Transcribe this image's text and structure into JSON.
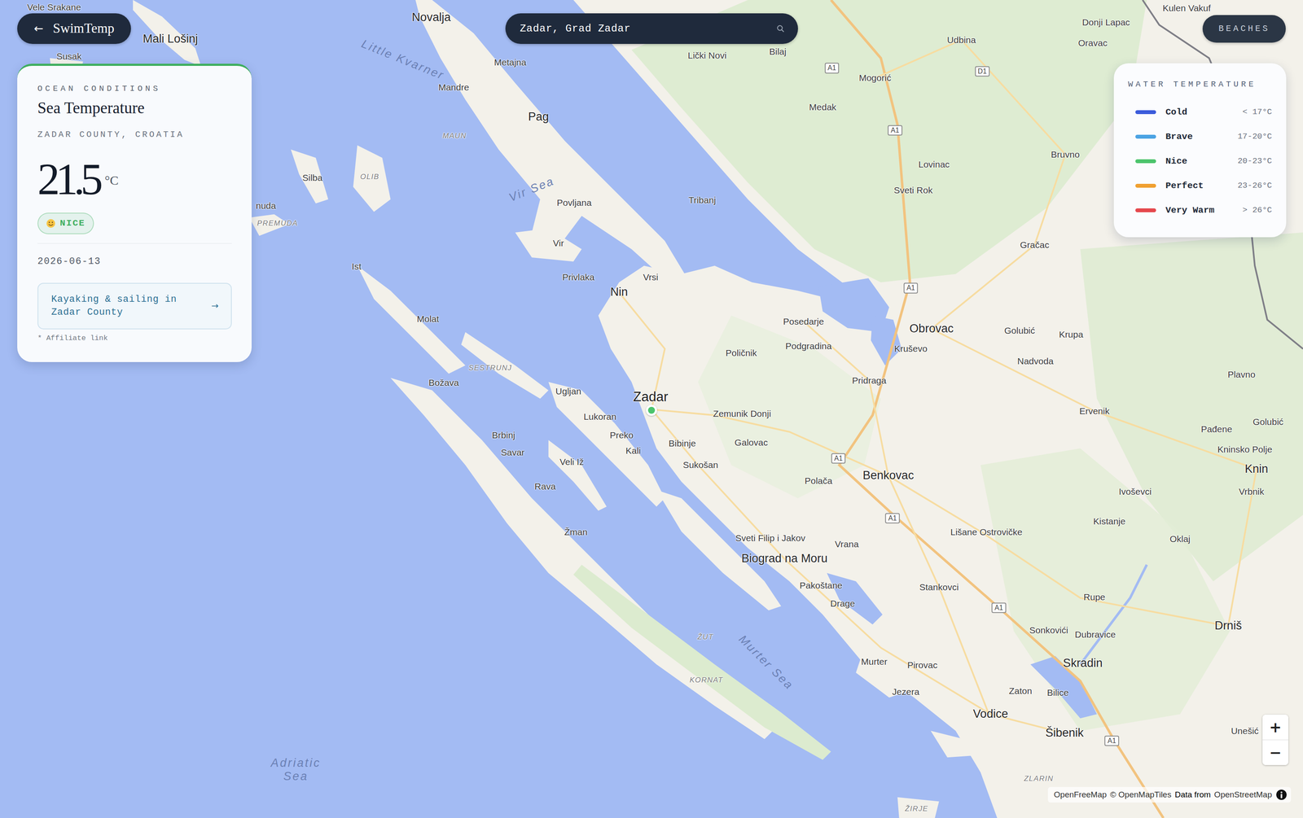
{
  "app": {
    "back_icon": "←",
    "title": "SwimTemp"
  },
  "search": {
    "value": "Zadar, Grad Zadar"
  },
  "beaches_button": "BEACHES",
  "conditions": {
    "eyebrow": "OCEAN CONDITIONS",
    "title": "Sea Temperature",
    "region": "ZADAR COUNTY, CROATIA",
    "temperature": "21.5",
    "unit": "°C",
    "rating": {
      "label": "NICE",
      "color": "#3fae5f"
    },
    "date": "2026-06-13",
    "affiliate": {
      "text": "Kayaking & sailing in Zadar County",
      "arrow": "→"
    },
    "affiliate_note": "* Affiliate link"
  },
  "legend": {
    "title": "WATER TEMPERATURE",
    "items": [
      {
        "label": "Cold",
        "range": "< 17°C",
        "color": "#3b5bdb"
      },
      {
        "label": "Brave",
        "range": "17-20°C",
        "color": "#4ba3e3"
      },
      {
        "label": "Nice",
        "range": "20-23°C",
        "color": "#4cc46c"
      },
      {
        "label": "Perfect",
        "range": "23-26°C",
        "color": "#f0a030"
      },
      {
        "label": "Very Warm",
        "range": "> 26°C",
        "color": "#e5484d"
      }
    ]
  },
  "map": {
    "pins": [
      {
        "color": "#4cc46c"
      }
    ],
    "labels": [
      {
        "text": "Vele Srakane",
        "kind": "town"
      },
      {
        "text": "Mali Lošinj",
        "kind": "city"
      },
      {
        "text": "Susak",
        "kind": "town"
      },
      {
        "text": "Novalja",
        "kind": "city"
      },
      {
        "text": "Metajna",
        "kind": "town"
      },
      {
        "text": "Mandre",
        "kind": "town"
      },
      {
        "text": "Pag",
        "kind": "city"
      },
      {
        "text": "Lički Novi",
        "kind": "town"
      },
      {
        "text": "Bilaj",
        "kind": "town"
      },
      {
        "text": "Medak",
        "kind": "town"
      },
      {
        "text": "Mogorić",
        "kind": "town"
      },
      {
        "text": "Udbina",
        "kind": "town"
      },
      {
        "text": "Donji Lapac",
        "kind": "town"
      },
      {
        "text": "Oravac",
        "kind": "town"
      },
      {
        "text": "Kulen Vakuf",
        "kind": "town"
      },
      {
        "text": "Bruvno",
        "kind": "town"
      },
      {
        "text": "Lovinac",
        "kind": "town"
      },
      {
        "text": "Sveti Rok",
        "kind": "town"
      },
      {
        "text": "Gračac",
        "kind": "town"
      },
      {
        "text": "Tribanj",
        "kind": "town"
      },
      {
        "text": "Povljana",
        "kind": "town"
      },
      {
        "text": "Vir",
        "kind": "town"
      },
      {
        "text": "Privlaka",
        "kind": "town"
      },
      {
        "text": "Vrsi",
        "kind": "town"
      },
      {
        "text": "Nin",
        "kind": "city"
      },
      {
        "text": "Posedarje",
        "kind": "town"
      },
      {
        "text": "Podgradina",
        "kind": "town"
      },
      {
        "text": "Obrovac",
        "kind": "city"
      },
      {
        "text": "Kruševo",
        "kind": "town"
      },
      {
        "text": "Golubić",
        "kind": "town"
      },
      {
        "text": "Krupa",
        "kind": "town"
      },
      {
        "text": "Nadvoda",
        "kind": "town"
      },
      {
        "text": "Poličnik",
        "kind": "town"
      },
      {
        "text": "Pridraga",
        "kind": "town"
      },
      {
        "text": "Plavno",
        "kind": "town"
      },
      {
        "text": "Ervenik",
        "kind": "town"
      },
      {
        "text": "Zadar",
        "kind": "capital"
      },
      {
        "text": "Zemunik Donji",
        "kind": "town"
      },
      {
        "text": "Bibinje",
        "kind": "town"
      },
      {
        "text": "Galovac",
        "kind": "town"
      },
      {
        "text": "Sukošan",
        "kind": "town"
      },
      {
        "text": "Ugljan",
        "kind": "town"
      },
      {
        "text": "Lukoran",
        "kind": "town"
      },
      {
        "text": "Preko",
        "kind": "town"
      },
      {
        "text": "Kali",
        "kind": "town"
      },
      {
        "text": "Molat",
        "kind": "town"
      },
      {
        "text": "Ist",
        "kind": "town"
      },
      {
        "text": "Silba",
        "kind": "town"
      },
      {
        "text": "Božava",
        "kind": "town"
      },
      {
        "text": "Brbinj",
        "kind": "town"
      },
      {
        "text": "Savar",
        "kind": "town"
      },
      {
        "text": "Veli Iž",
        "kind": "town"
      },
      {
        "text": "Rava",
        "kind": "town"
      },
      {
        "text": "Žman",
        "kind": "town"
      },
      {
        "text": "Polača",
        "kind": "town"
      },
      {
        "text": "Benkovac",
        "kind": "city"
      },
      {
        "text": "Pađene",
        "kind": "town"
      },
      {
        "text": "Golubić",
        "kind": "town"
      },
      {
        "text": "Kninsko Polje",
        "kind": "town"
      },
      {
        "text": "Knin",
        "kind": "city"
      },
      {
        "text": "Vrbnik",
        "kind": "town"
      },
      {
        "text": "Ivoševci",
        "kind": "town"
      },
      {
        "text": "Kistanje",
        "kind": "town"
      },
      {
        "text": "Oklaj",
        "kind": "town"
      },
      {
        "text": "Lišane Ostrovičke",
        "kind": "town"
      },
      {
        "text": "Sveti Filip i Jakov",
        "kind": "town"
      },
      {
        "text": "Biograd na Moru",
        "kind": "city"
      },
      {
        "text": "Vrana",
        "kind": "town"
      },
      {
        "text": "Pakoštane",
        "kind": "town"
      },
      {
        "text": "Drage",
        "kind": "town"
      },
      {
        "text": "Stankovci",
        "kind": "town"
      },
      {
        "text": "Rupe",
        "kind": "town"
      },
      {
        "text": "Sonkovići",
        "kind": "town"
      },
      {
        "text": "Dubravice",
        "kind": "town"
      },
      {
        "text": "Drniš",
        "kind": "city"
      },
      {
        "text": "Skradin",
        "kind": "city"
      },
      {
        "text": "Murter",
        "kind": "town"
      },
      {
        "text": "Pirovac",
        "kind": "town"
      },
      {
        "text": "Jezera",
        "kind": "town"
      },
      {
        "text": "Zaton",
        "kind": "town"
      },
      {
        "text": "Bilice",
        "kind": "town"
      },
      {
        "text": "Vodice",
        "kind": "city"
      },
      {
        "text": "Šibenik",
        "kind": "city"
      },
      {
        "text": "Unešić",
        "kind": "town"
      },
      {
        "text": "nuda",
        "kind": "town"
      },
      {
        "text": "MAUN",
        "kind": "island"
      },
      {
        "text": "OLIB",
        "kind": "island"
      },
      {
        "text": "PREMUDA",
        "kind": "island"
      },
      {
        "text": "SESTRUNJ",
        "kind": "island"
      },
      {
        "text": "ŽUT",
        "kind": "island"
      },
      {
        "text": "KORNAT",
        "kind": "island"
      },
      {
        "text": "ZLARIN",
        "kind": "island"
      },
      {
        "text": "ŽIRJE",
        "kind": "island"
      },
      {
        "text": "Little Kvarner",
        "kind": "sea"
      },
      {
        "text": "Vir Sea",
        "kind": "sea"
      },
      {
        "text": "Murter Sea",
        "kind": "sea"
      },
      {
        "text": "Adriatic Sea",
        "kind": "sea"
      },
      {
        "text": "A1",
        "kind": "road"
      },
      {
        "text": "D1",
        "kind": "road"
      },
      {
        "text": "A1",
        "kind": "road"
      },
      {
        "text": "A1",
        "kind": "road"
      },
      {
        "text": "A1",
        "kind": "road"
      },
      {
        "text": "A1",
        "kind": "road"
      },
      {
        "text": "A1",
        "kind": "road"
      },
      {
        "text": "A1",
        "kind": "road"
      }
    ]
  },
  "zoom": {
    "in": "+",
    "out": "−"
  },
  "attribution": [
    {
      "text": "OpenFreeMap",
      "kind": "link"
    },
    {
      "text": "© OpenMapTiles",
      "kind": "link"
    },
    {
      "text": "Data from",
      "kind": "text"
    },
    {
      "text": "OpenStreetMap",
      "kind": "link"
    }
  ]
}
